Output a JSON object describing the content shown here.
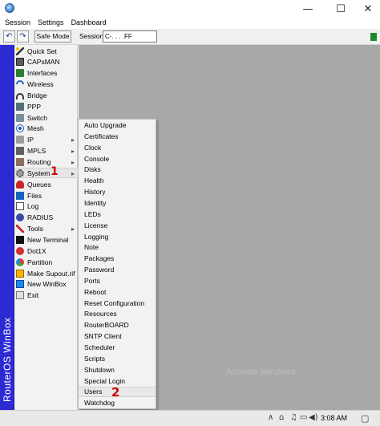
{
  "window": {
    "minimize_glyph": "—",
    "maximize_glyph": "☐",
    "close_glyph": "✕"
  },
  "menubar": [
    "Session",
    "Settings",
    "Dashboard"
  ],
  "toolbar": {
    "undo_glyph": "↶",
    "redo_glyph": "↷",
    "safe_mode_label": "Safe Mode",
    "session_label": "Session:",
    "session_value": "C-.  .  .       .FF"
  },
  "strip_label": "RouterOS WinBox",
  "side_menu": [
    {
      "label": "Quick Set",
      "icon": "wand-icon",
      "arrow": ""
    },
    {
      "label": "CAPsMAN",
      "icon": "capsman-icon",
      "arrow": ""
    },
    {
      "label": "Interfaces",
      "icon": "interfaces-icon",
      "arrow": ""
    },
    {
      "label": "Wireless",
      "icon": "wireless-icon",
      "arrow": ""
    },
    {
      "label": "Bridge",
      "icon": "bridge-icon",
      "arrow": ""
    },
    {
      "label": "PPP",
      "icon": "ppp-icon",
      "arrow": ""
    },
    {
      "label": "Switch",
      "icon": "switch-icon",
      "arrow": ""
    },
    {
      "label": "Mesh",
      "icon": "mesh-icon",
      "arrow": ""
    },
    {
      "label": "IP",
      "icon": "ip-icon",
      "arrow": "▸"
    },
    {
      "label": "MPLS",
      "icon": "mpls-icon",
      "arrow": "▸"
    },
    {
      "label": "Routing",
      "icon": "routing-icon",
      "arrow": "▸"
    },
    {
      "label": "System",
      "icon": "system-icon",
      "arrow": "▸"
    },
    {
      "label": "Queues",
      "icon": "queues-icon",
      "arrow": ""
    },
    {
      "label": "Files",
      "icon": "files-icon",
      "arrow": ""
    },
    {
      "label": "Log",
      "icon": "log-icon",
      "arrow": ""
    },
    {
      "label": "RADIUS",
      "icon": "radius-icon",
      "arrow": ""
    },
    {
      "label": "Tools",
      "icon": "tools-icon",
      "arrow": "▸"
    },
    {
      "label": "New Terminal",
      "icon": "terminal-icon",
      "arrow": ""
    },
    {
      "label": "Dot1X",
      "icon": "dot1x-icon",
      "arrow": ""
    },
    {
      "label": "Partition",
      "icon": "partition-icon",
      "arrow": ""
    },
    {
      "label": "Make Supout.rif",
      "icon": "supout-icon",
      "arrow": ""
    },
    {
      "label": "New WinBox",
      "icon": "new-winbox-icon",
      "arrow": ""
    },
    {
      "label": "Exit",
      "icon": "exit-icon",
      "arrow": ""
    }
  ],
  "system_submenu": [
    "Auto Upgrade",
    "Certificates",
    "Clock",
    "Console",
    "Disks",
    "Health",
    "History",
    "Identity",
    "LEDs",
    "License",
    "Logging",
    "Note",
    "Packages",
    "Password",
    "Ports",
    "Reboot",
    "Reset Configuration",
    "Resources",
    "RouterBOARD",
    "SNTP Client",
    "Scheduler",
    "Scripts",
    "Shutdown",
    "Special Login",
    "Users",
    "Watchdog"
  ],
  "annotations": {
    "marker_1": "1",
    "marker_2": "2"
  },
  "watermark": "Activate Windows",
  "taskbar": {
    "tray_up_glyph": "∧",
    "tray_glyphs": [
      "⌂",
      "♫",
      "▭",
      "◀)"
    ],
    "clock": "3:08 AM",
    "notification_glyph": "▢"
  },
  "colors": {
    "strip": "#2d2ad4",
    "workarea": "#a8a8a8",
    "marker": "#d00000",
    "status": "#1b8a2a"
  }
}
